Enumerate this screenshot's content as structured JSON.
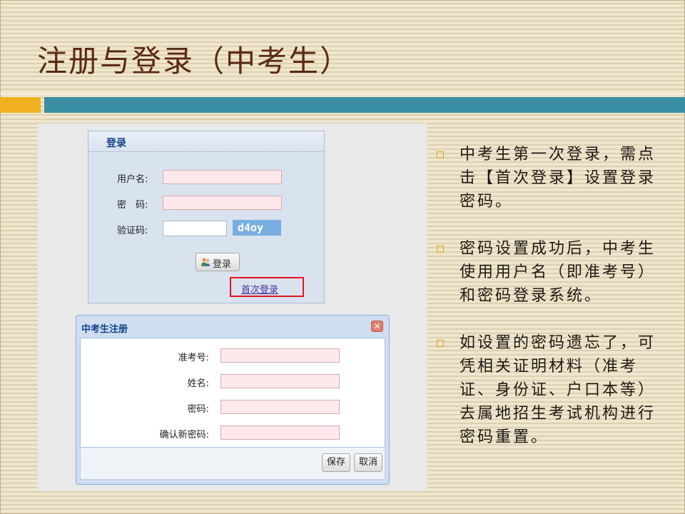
{
  "slide": {
    "title": "注册与登录（中考生）"
  },
  "login": {
    "header": "登录",
    "username_label": "用户名:",
    "password_label": "密　码:",
    "captcha_label": "验证码:",
    "captcha_text": "d4oy",
    "login_button": "登录",
    "first_login_link": "首次登录"
  },
  "register_dialog": {
    "title": "中考生注册",
    "fields": [
      {
        "label": "准考号:"
      },
      {
        "label": "姓名:"
      },
      {
        "label": "密码:"
      },
      {
        "label": "确认新密码:"
      }
    ],
    "save_button": "保存",
    "cancel_button": "取消"
  },
  "bullets": [
    {
      "text": "中考生第一次登录，需点击【首次登录】设置登录密码。"
    },
    {
      "text": "密码设置成功后，中考生使用用户名（即准考号）和密码登录系统。"
    },
    {
      "text": "如设置的密码遗忘了，可凭相关证明材料（准考证、身份证、户口本等）去属地招生考试机构进行密码重置。"
    }
  ],
  "colors": {
    "title": "#5b2a12",
    "accent_orange": "#f0b020",
    "accent_teal": "#3a8fa2",
    "highlight_red": "#e4141e"
  }
}
